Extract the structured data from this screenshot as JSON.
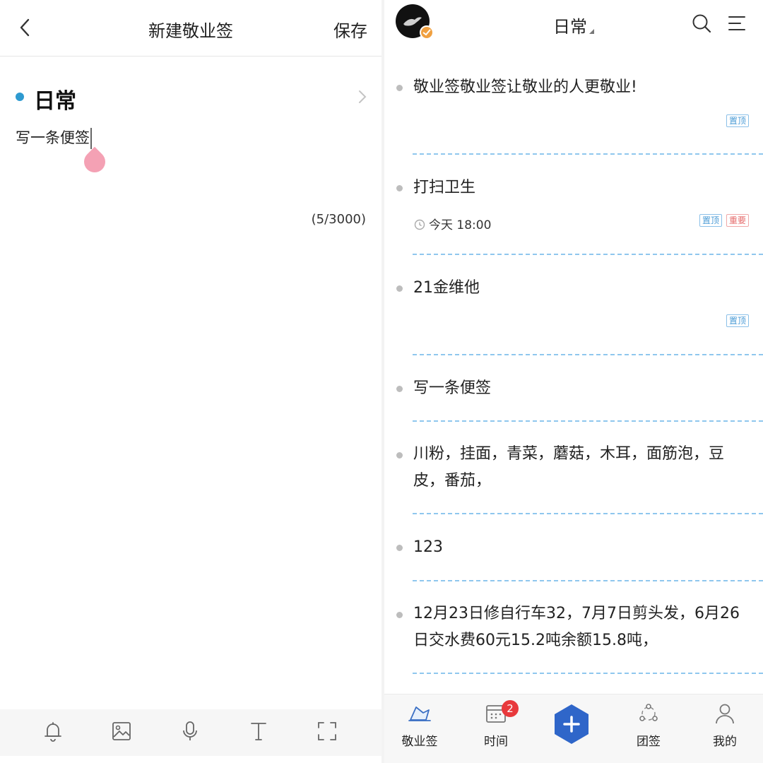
{
  "left": {
    "header": {
      "title": "新建敬业签",
      "save_label": "保存"
    },
    "category": {
      "name": "日常"
    },
    "note": {
      "text": "写一条便签"
    },
    "counter": "(5/3000)",
    "toolbar": [
      "bell-icon",
      "image-icon",
      "microphone-icon",
      "text-format-icon",
      "fullscreen-icon"
    ]
  },
  "right": {
    "header": {
      "title": "日常"
    },
    "notes": [
      {
        "text": "敬业签敬业签让敬业的人更敬业!",
        "tags": [
          "置顶"
        ]
      },
      {
        "text": "打扫卫生",
        "time": "今天 18:00",
        "tags": [
          "置顶",
          "重要"
        ]
      },
      {
        "text": "21金维他",
        "tags": [
          "置顶"
        ]
      },
      {
        "text": "写一条便签",
        "tags": []
      },
      {
        "text": "川粉，挂面，青菜，蘑菇，木耳，面筋泡，豆皮，番茄，",
        "tags": []
      },
      {
        "text": "123",
        "tags": []
      },
      {
        "text": "12月23日修自行车32，7月7日剪头发，6月26日交水费60元15.2吨余额15.8吨，",
        "tags": []
      }
    ],
    "tabbar": {
      "tabs": [
        {
          "label": "敬业签"
        },
        {
          "label": "时间",
          "badge": "2"
        },
        {
          "label": "团签"
        },
        {
          "label": "我的"
        }
      ]
    }
  },
  "colors": {
    "accent": "#2e9ad0",
    "fab": "#2f66c9",
    "badge": "#e8393c",
    "separator": "#8fc7ee"
  }
}
